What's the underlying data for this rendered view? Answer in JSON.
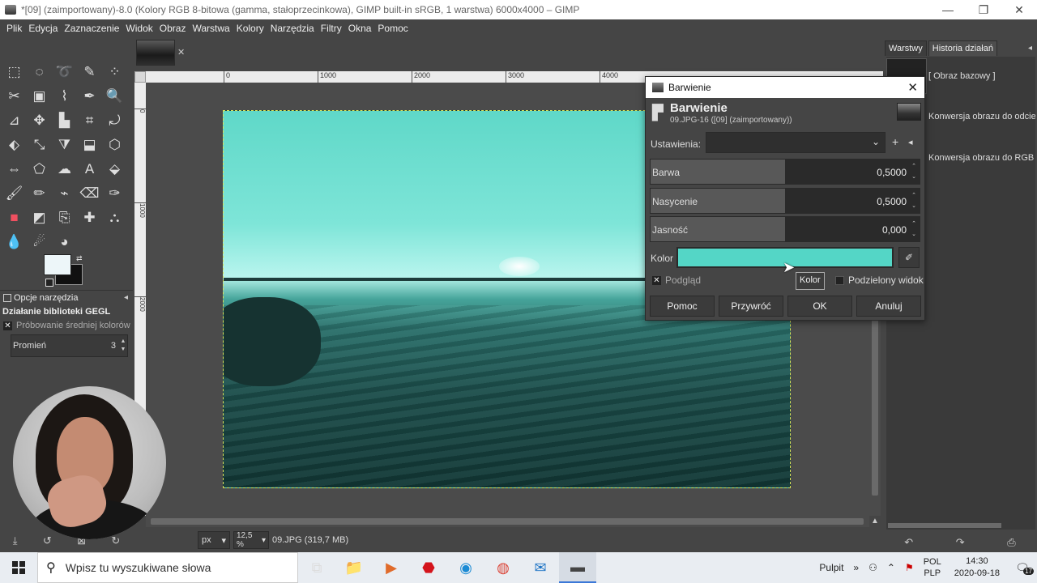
{
  "window": {
    "title": "*[09] (zaimportowany)-8.0 (Kolory RGB 8-bitowa (gamma, stałoprzecinkowa), GIMP built-in sRGB, 1 warstwa) 6000x4000 – GIMP",
    "minimize_glyph": "—",
    "restore_glyph": "❐",
    "close_glyph": "✕"
  },
  "menu": [
    "Plik",
    "Edycja",
    "Zaznaczenie",
    "Widok",
    "Obraz",
    "Warstwa",
    "Kolory",
    "Narzędzia",
    "Filtry",
    "Okna",
    "Pomoc"
  ],
  "toolbox": {
    "tools": [
      {
        "icon": "rect-select-icon",
        "glyph": "⬚"
      },
      {
        "icon": "ellipse-select-icon",
        "glyph": "◌"
      },
      {
        "icon": "lasso-icon",
        "glyph": "➰"
      },
      {
        "icon": "fuzzy-select-icon",
        "glyph": "✎"
      },
      {
        "icon": "by-color-select-icon",
        "glyph": "⁘"
      },
      {
        "icon": "scissors-icon",
        "glyph": "✂"
      },
      {
        "icon": "foreground-select-icon",
        "glyph": "▣"
      },
      {
        "icon": "paths-icon",
        "glyph": "⌇"
      },
      {
        "icon": "color-picker-icon",
        "glyph": "✒"
      },
      {
        "icon": "zoom-icon",
        "glyph": "🔍"
      },
      {
        "icon": "measure-icon",
        "glyph": "⊿"
      },
      {
        "icon": "move-icon",
        "glyph": "✥"
      },
      {
        "icon": "align-icon",
        "glyph": "▙"
      },
      {
        "icon": "crop-icon",
        "glyph": "⌗"
      },
      {
        "icon": "transform-icon",
        "glyph": "⤾"
      },
      {
        "icon": "warp-icon",
        "glyph": "⬖"
      },
      {
        "icon": "scale-icon",
        "glyph": "⤡"
      },
      {
        "icon": "shear-icon",
        "glyph": "⧩"
      },
      {
        "icon": "perspective-icon",
        "glyph": "⬓"
      },
      {
        "icon": "3d-transform-icon",
        "glyph": "⬡"
      },
      {
        "icon": "flip-icon",
        "glyph": "⇔"
      },
      {
        "icon": "cage-icon",
        "glyph": "⬠"
      },
      {
        "icon": "smudge-warp-icon",
        "glyph": "☁"
      },
      {
        "icon": "text-icon",
        "glyph": "A"
      },
      {
        "icon": "bucket-fill-icon",
        "glyph": "⬙"
      },
      {
        "icon": "paintbrush-icon",
        "glyph": "🖌"
      },
      {
        "icon": "pencil-icon",
        "glyph": "✏"
      },
      {
        "icon": "airbrush-icon",
        "glyph": "⌁"
      },
      {
        "icon": "eraser-icon",
        "glyph": "⌫"
      },
      {
        "icon": "ink-icon",
        "glyph": "✑"
      },
      {
        "icon": "mypaint-brush-icon",
        "glyph": "■"
      },
      {
        "icon": "gradient-icon",
        "glyph": "◩"
      },
      {
        "icon": "clone-icon",
        "glyph": "⎘"
      },
      {
        "icon": "heal-icon",
        "glyph": "✚"
      },
      {
        "icon": "stamp-icon",
        "glyph": "⛬"
      },
      {
        "icon": "blur-icon",
        "glyph": "💧"
      },
      {
        "icon": "smudge-icon",
        "glyph": "☄"
      },
      {
        "icon": "dodge-burn-icon",
        "glyph": "◕"
      }
    ],
    "options_tab": "Opcje narzędzia",
    "options_menu_glyph": "◂",
    "options_title": "Działanie biblioteki GEGL",
    "sample_average": {
      "label": "Próbowanie średniej kolorów",
      "checked_glyph": "✕"
    },
    "radius": {
      "label": "Promień",
      "value": "3"
    },
    "spin_up": "▲",
    "spin_down": "▼",
    "bottom_icons": [
      {
        "icon": "save-options-icon",
        "glyph": "⤓"
      },
      {
        "icon": "restore-options-icon",
        "glyph": "↺"
      },
      {
        "icon": "delete-options-icon",
        "glyph": "⊠"
      },
      {
        "icon": "reset-options-icon",
        "glyph": "↻"
      }
    ],
    "swap_glyph": "⇄"
  },
  "image_window": {
    "tab_close_glyph": "✕",
    "ruler_labels": [
      "0",
      "1000",
      "2000",
      "3000",
      "4000"
    ],
    "left_ruler_labels": [
      "0",
      "1000",
      "2000"
    ],
    "status_unit": "px",
    "status_zoom": "12,5 %",
    "status_text": "09.JPG (319,7 MB)",
    "dropdown_glyph": "▾",
    "nav_glyph": "▲"
  },
  "right_dock": {
    "tabs": [
      "Warstwy",
      "Historia działań"
    ],
    "menu_glyph": "◂",
    "history": [
      "[ Obraz bazowy ]",
      "Konwersja obrazu do odcieni",
      "Konwersja obrazu do RGB"
    ],
    "bottom_icons": [
      {
        "icon": "undo-icon",
        "glyph": "↶"
      },
      {
        "icon": "redo-icon",
        "glyph": "↷"
      },
      {
        "icon": "clear-history-icon",
        "glyph": "⎙"
      }
    ]
  },
  "dialog": {
    "window_title": "Barwienie",
    "close_glyph": "✕",
    "header_title": "Barwienie",
    "header_subtitle": "09.JPG-16 ([09] (zaimportowany))",
    "settings_label": "Ustawienia:",
    "settings_chevron": "⌄",
    "add_glyph": "+",
    "menu_glyph": "◂",
    "sliders": [
      {
        "label": "Barwa",
        "value": "0,5000",
        "fraction": 0.5
      },
      {
        "label": "Nasycenie",
        "value": "0,5000",
        "fraction": 0.5
      },
      {
        "label": "Jasność",
        "value": "0,000",
        "fraction": 0.5
      }
    ],
    "color_label": "Kolor",
    "color_value": "#54d6c6",
    "picker_glyph": "✐",
    "preview_label": "Podgląd",
    "preview_checked_glyph": "✕",
    "tooltip": "Kolor",
    "split_view_label": "Podzielony widok",
    "buttons": {
      "help": "Pomoc",
      "reset": "Przywróć",
      "ok": "OK",
      "cancel": "Anuluj"
    }
  },
  "cursor_glyph": "➤",
  "taskbar": {
    "search_placeholder": "Wpisz tu wyszukiwane słowa",
    "search_glyph": "⚲",
    "apps": [
      {
        "icon": "task-view-icon",
        "glyph": "⧉"
      },
      {
        "icon": "file-explorer-icon",
        "glyph": "📁"
      },
      {
        "icon": "media-player-icon",
        "glyph": "▶"
      },
      {
        "icon": "acrobat-icon",
        "glyph": "⬣"
      },
      {
        "icon": "edge-icon",
        "glyph": "◉"
      },
      {
        "icon": "chrome-icon",
        "glyph": "◍"
      },
      {
        "icon": "mail-icon",
        "glyph": "✉"
      },
      {
        "icon": "gimp-taskbar-icon",
        "glyph": "▬"
      }
    ],
    "tray": {
      "desktop_label": "Pulpit",
      "desktop_chevron": "»",
      "people_glyph": "⚇",
      "up_glyph": "⌃",
      "network_glyph": "⚑",
      "lang_top": "POL",
      "lang_bottom": "PLP",
      "time": "14:30",
      "date": "2020-09-18",
      "notif_glyph": "🗨",
      "notif_count": "17"
    }
  }
}
